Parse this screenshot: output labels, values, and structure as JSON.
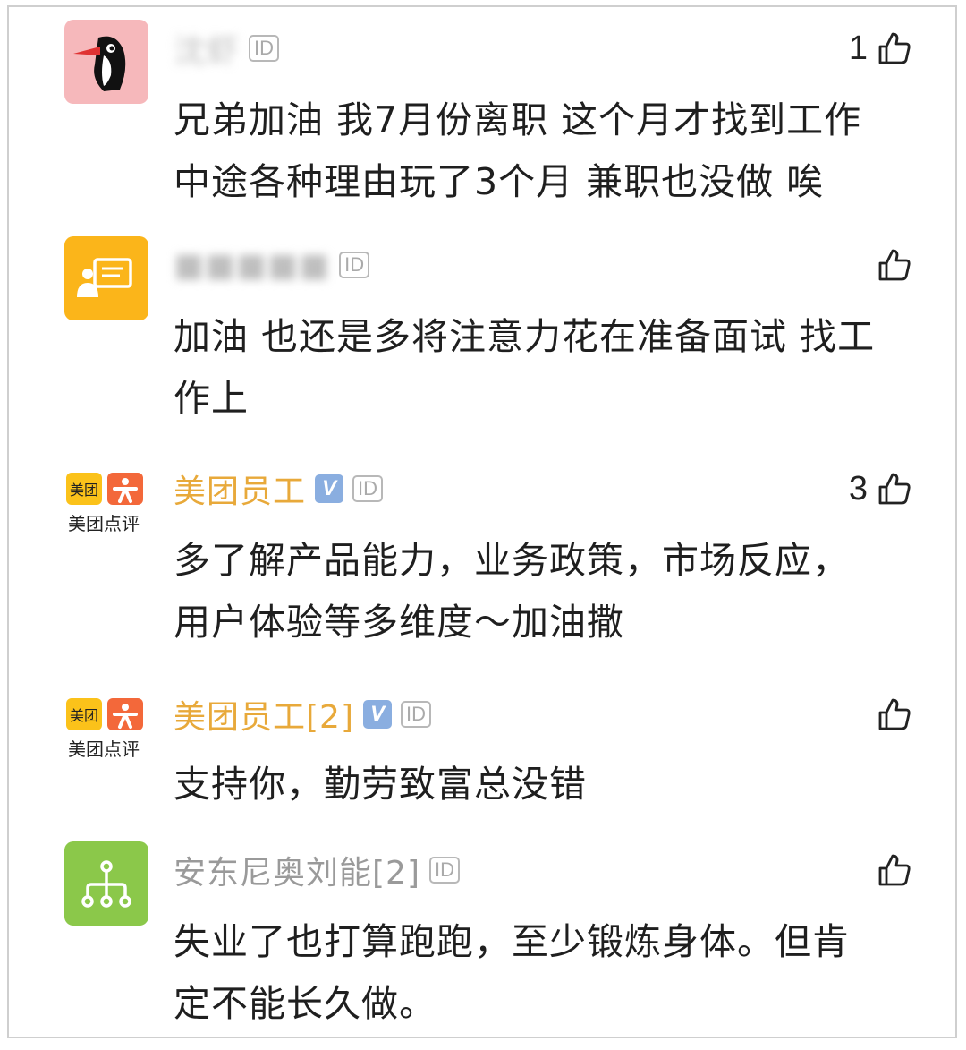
{
  "comments": [
    {
      "username": "沈虾",
      "id_badge": "ID",
      "like_count": "1",
      "text_lines": [
        "兄弟加油  我7月份离职 这个月才找到工作",
        "中途各种理由玩了3个月 兼职也没做  唉"
      ],
      "avatar_icon": "woodpecker-icon"
    },
    {
      "username": "■■■■■",
      "id_badge": "ID",
      "like_count": "",
      "text_lines": [
        "加油 也还是多将注意力花在准备面试 找工",
        "作上"
      ],
      "avatar_icon": "presenter-icon"
    },
    {
      "username": "美团员工",
      "verified_badge": "V",
      "id_badge": "ID",
      "like_count": "3",
      "text_lines": [
        "多了解产品能力，业务政策，市场反应，",
        "用户体验等多维度～加油撒"
      ],
      "avatar_text_top": "美团",
      "avatar_text_bottom": "美团点评"
    },
    {
      "username": "美团员工[2]",
      "verified_badge": "V",
      "id_badge": "ID",
      "like_count": "",
      "text_lines": [
        "支持你，勤劳致富总没错"
      ],
      "avatar_text_top": "美团",
      "avatar_text_bottom": "美团点评"
    },
    {
      "username": "安东尼奥刘能[2]",
      "id_badge": "ID",
      "like_count": "",
      "text_lines": [
        "失业了也打算跑跑，至少锻炼身体。但肯",
        "定不能长久做。"
      ],
      "avatar_icon": "org-tree-icon"
    }
  ],
  "colors": {
    "meituan_name": "#e8a93a",
    "verified_badge": "#8aaee0",
    "avatar_pink": "#f6b8bb",
    "avatar_orange": "#fbb51a",
    "avatar_green": "#8bc84a"
  }
}
